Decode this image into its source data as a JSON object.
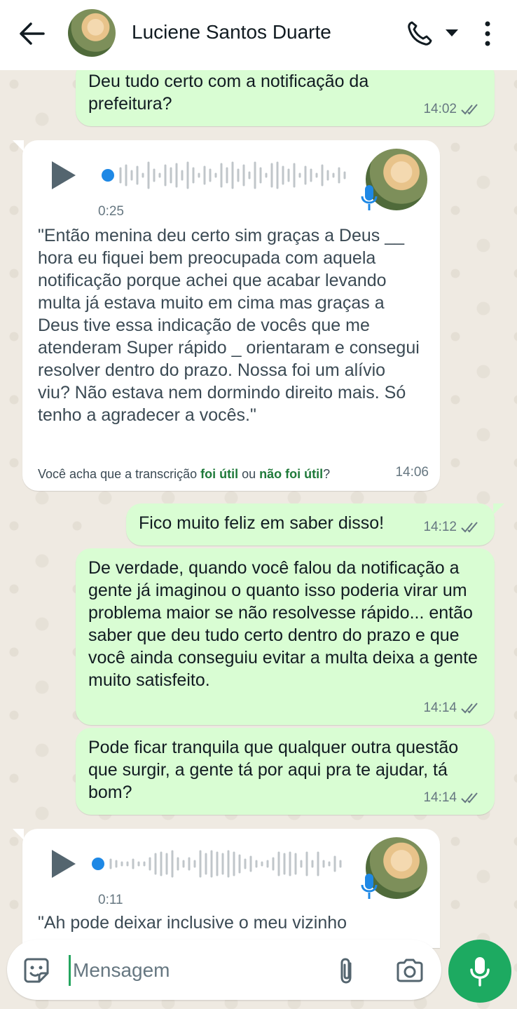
{
  "header": {
    "contact_name": "Luciene Santos Duarte"
  },
  "messages": [
    {
      "type": "out",
      "text": "Deu tudo certo com a notificação da prefeitura?",
      "time": "14:02"
    },
    {
      "type": "voice",
      "duration": "0:25",
      "transcript": "\"Então menina deu certo sim graças a Deus __ hora eu fiquei bem preocupada com aquela notificação porque achei que acabar levando multa já estava muito em cima mas graças a Deus tive essa indicação de vocês que me atenderam Super rápido _ orientaram e consegui resolver dentro do prazo. Nossa foi um alívio viu? Não estava nem dormindo direito mais. Só tenho a agradecer a vocês.\"",
      "feedback_prefix": "Você acha que a transcrição ",
      "feedback_yes": "foi útil",
      "feedback_mid": " ou ",
      "feedback_no": "não foi útil",
      "feedback_suffix": "?",
      "time": "14:06"
    },
    {
      "type": "out",
      "text": "Fico muito feliz em saber disso!",
      "time": "14:12"
    },
    {
      "type": "out",
      "text": "De verdade, quando você falou da notificação a gente já imaginou o quanto isso poderia virar um problema maior se não resolvesse rápido... então saber que deu tudo certo dentro do prazo e que você ainda conseguiu evitar a multa deixa a gente muito satisfeito.",
      "time": "14:14"
    },
    {
      "type": "out",
      "text": "Pode ficar tranquila que qualquer outra questão que surgir, a gente tá por aqui pra te ajudar, tá bom?",
      "time": "14:14"
    },
    {
      "type": "voice",
      "duration": "0:11",
      "transcript": "\"Ah pode deixar inclusive o meu vizinho"
    }
  ],
  "composer": {
    "placeholder": "Mensagem"
  },
  "colors": {
    "outgoing_bubble": "#d9fdd3",
    "incoming_bubble": "#ffffff",
    "accent": "#1daa61",
    "read_ticks": "#667781"
  }
}
